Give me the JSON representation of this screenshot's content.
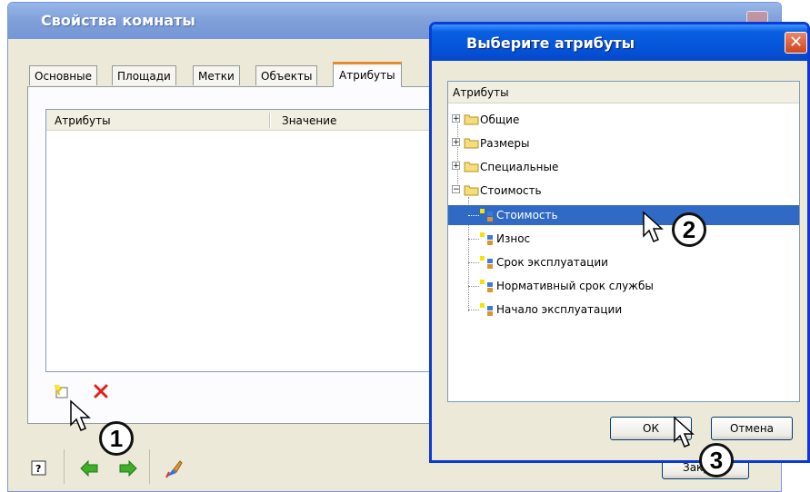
{
  "back_window": {
    "title": "Свойства комнаты",
    "tabs": [
      "Основные",
      "Площади",
      "Метки",
      "Объекты"
    ],
    "active_tab": "Атрибуты",
    "columns": [
      "Атрибуты",
      "Значение"
    ],
    "close_button_label": "Закрыть"
  },
  "dialog": {
    "title": "Выберите атрибуты",
    "close_glyph": "✕",
    "tree_header": "Атрибуты",
    "tree": {
      "groups": [
        {
          "label": "Общие",
          "expander": "+"
        },
        {
          "label": "Размеры",
          "expander": "+"
        },
        {
          "label": "Специальные",
          "expander": "+"
        },
        {
          "label": "Стоимость",
          "expander": "−"
        }
      ],
      "children": [
        "Стоимость",
        "Износ",
        "Срок эксплуатации",
        "Нормативный срок службы",
        "Начало эксплуатации"
      ],
      "selected_child_index": 0
    },
    "ok_label": "ОК",
    "cancel_label": "Отмена"
  },
  "markers": [
    "1",
    "2",
    "3"
  ],
  "colors": {
    "selection": "#316ac5",
    "dialog_border": "#0a3bd6",
    "active_tab_accent": "#e68b2c",
    "delete_x": "#e0201b",
    "arrows": "#3fae2a"
  },
  "icons": [
    "new-attribute-icon",
    "delete-icon",
    "help-icon",
    "back-arrow-icon",
    "forward-arrow-icon",
    "brush-icon",
    "folder-icon",
    "attribute-node-icon",
    "cursor-icon"
  ]
}
